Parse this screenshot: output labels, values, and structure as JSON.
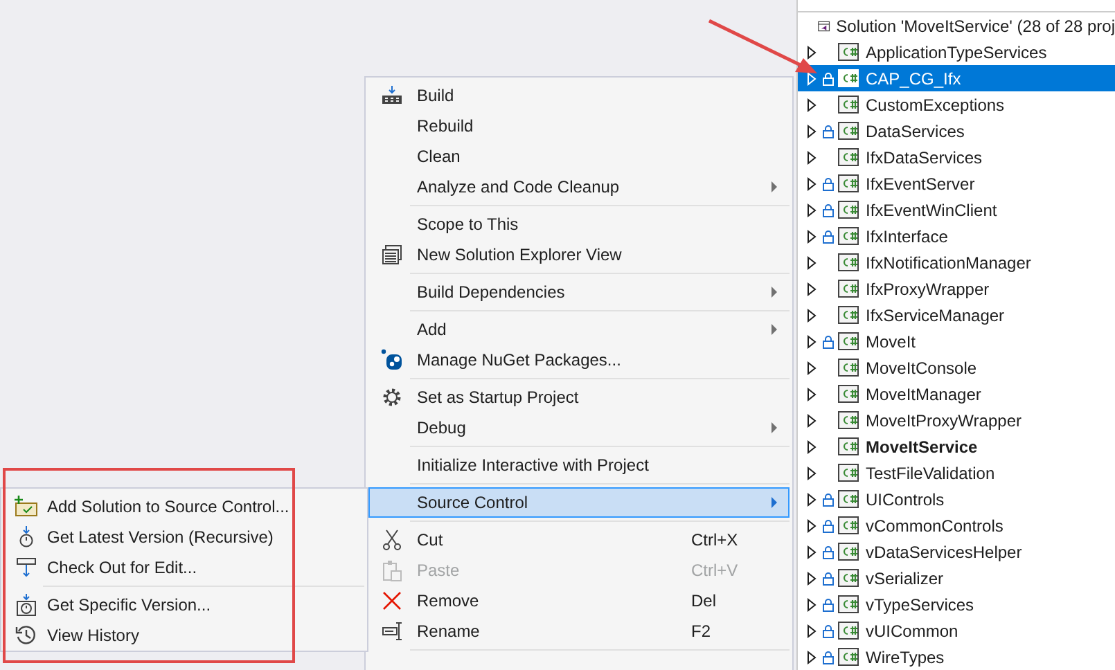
{
  "solution_explorer": {
    "solution_label": "Solution 'MoveItService' (28 of 28 proj",
    "projects": [
      {
        "name": "ApplicationTypeServices",
        "locked": false,
        "selected": false,
        "startup": false
      },
      {
        "name": "CAP_CG_Ifx",
        "locked": true,
        "selected": true,
        "startup": false
      },
      {
        "name": "CustomExceptions",
        "locked": false,
        "selected": false,
        "startup": false
      },
      {
        "name": "DataServices",
        "locked": true,
        "selected": false,
        "startup": false
      },
      {
        "name": "IfxDataServices",
        "locked": false,
        "selected": false,
        "startup": false
      },
      {
        "name": "IfxEventServer",
        "locked": true,
        "selected": false,
        "startup": false
      },
      {
        "name": "IfxEventWinClient",
        "locked": true,
        "selected": false,
        "startup": false
      },
      {
        "name": "IfxInterface",
        "locked": true,
        "selected": false,
        "startup": false
      },
      {
        "name": "IfxNotificationManager",
        "locked": false,
        "selected": false,
        "startup": false
      },
      {
        "name": "IfxProxyWrapper",
        "locked": false,
        "selected": false,
        "startup": false
      },
      {
        "name": "IfxServiceManager",
        "locked": false,
        "selected": false,
        "startup": false
      },
      {
        "name": "MoveIt",
        "locked": true,
        "selected": false,
        "startup": false
      },
      {
        "name": "MoveItConsole",
        "locked": false,
        "selected": false,
        "startup": false
      },
      {
        "name": "MoveItManager",
        "locked": false,
        "selected": false,
        "startup": false
      },
      {
        "name": "MoveItProxyWrapper",
        "locked": false,
        "selected": false,
        "startup": false
      },
      {
        "name": "MoveItService",
        "locked": false,
        "selected": false,
        "startup": true
      },
      {
        "name": "TestFileValidation",
        "locked": false,
        "selected": false,
        "startup": false
      },
      {
        "name": "UIControls",
        "locked": true,
        "selected": false,
        "startup": false
      },
      {
        "name": "vCommonControls",
        "locked": true,
        "selected": false,
        "startup": false
      },
      {
        "name": "vDataServicesHelper",
        "locked": true,
        "selected": false,
        "startup": false
      },
      {
        "name": "vSerializer",
        "locked": true,
        "selected": false,
        "startup": false
      },
      {
        "name": "vTypeServices",
        "locked": true,
        "selected": false,
        "startup": false
      },
      {
        "name": "vUICommon",
        "locked": true,
        "selected": false,
        "startup": false
      },
      {
        "name": "WireTypes",
        "locked": true,
        "selected": false,
        "startup": false
      }
    ]
  },
  "context_menu": {
    "items": [
      {
        "kind": "item",
        "label": "Build",
        "submenu": false,
        "disabled": false,
        "selected": false
      },
      {
        "kind": "item",
        "label": "Rebuild",
        "submenu": false,
        "disabled": false,
        "selected": false
      },
      {
        "kind": "item",
        "label": "Clean",
        "submenu": false,
        "disabled": false,
        "selected": false
      },
      {
        "kind": "item",
        "label": "Analyze and Code Cleanup",
        "submenu": true,
        "disabled": false,
        "selected": false
      },
      {
        "kind": "separator"
      },
      {
        "kind": "item",
        "label": "Scope to This",
        "submenu": false,
        "disabled": false,
        "selected": false
      },
      {
        "kind": "item",
        "label": "New Solution Explorer View",
        "submenu": false,
        "disabled": false,
        "selected": false
      },
      {
        "kind": "separator"
      },
      {
        "kind": "item",
        "label": "Build Dependencies",
        "submenu": true,
        "disabled": false,
        "selected": false
      },
      {
        "kind": "separator"
      },
      {
        "kind": "item",
        "label": "Add",
        "submenu": true,
        "disabled": false,
        "selected": false
      },
      {
        "kind": "item",
        "label": "Manage NuGet Packages...",
        "submenu": false,
        "disabled": false,
        "selected": false
      },
      {
        "kind": "separator"
      },
      {
        "kind": "item",
        "label": "Set as Startup Project",
        "submenu": false,
        "disabled": false,
        "selected": false
      },
      {
        "kind": "item",
        "label": "Debug",
        "submenu": true,
        "disabled": false,
        "selected": false
      },
      {
        "kind": "separator"
      },
      {
        "kind": "item",
        "label": "Initialize Interactive with Project",
        "submenu": false,
        "disabled": false,
        "selected": false
      },
      {
        "kind": "separator"
      },
      {
        "kind": "item",
        "label": "Source Control",
        "submenu": true,
        "disabled": false,
        "selected": true
      },
      {
        "kind": "separator"
      },
      {
        "kind": "item",
        "label": "Cut",
        "shortcut": "Ctrl+X",
        "submenu": false,
        "disabled": false,
        "selected": false
      },
      {
        "kind": "item",
        "label": "Paste",
        "shortcut": "Ctrl+V",
        "submenu": false,
        "disabled": true,
        "selected": false
      },
      {
        "kind": "item",
        "label": "Remove",
        "shortcut": "Del",
        "submenu": false,
        "disabled": false,
        "selected": false
      },
      {
        "kind": "item",
        "label": "Rename",
        "shortcut": "F2",
        "submenu": false,
        "disabled": false,
        "selected": false
      },
      {
        "kind": "separator"
      }
    ]
  },
  "source_control_submenu": {
    "items": [
      {
        "kind": "item",
        "label": "Add Solution to Source Control..."
      },
      {
        "kind": "item",
        "label": "Get Latest Version (Recursive)"
      },
      {
        "kind": "item",
        "label": "Check Out for Edit..."
      },
      {
        "kind": "separator"
      },
      {
        "kind": "item",
        "label": "Get Specific Version..."
      },
      {
        "kind": "item",
        "label": "View History"
      }
    ]
  }
}
